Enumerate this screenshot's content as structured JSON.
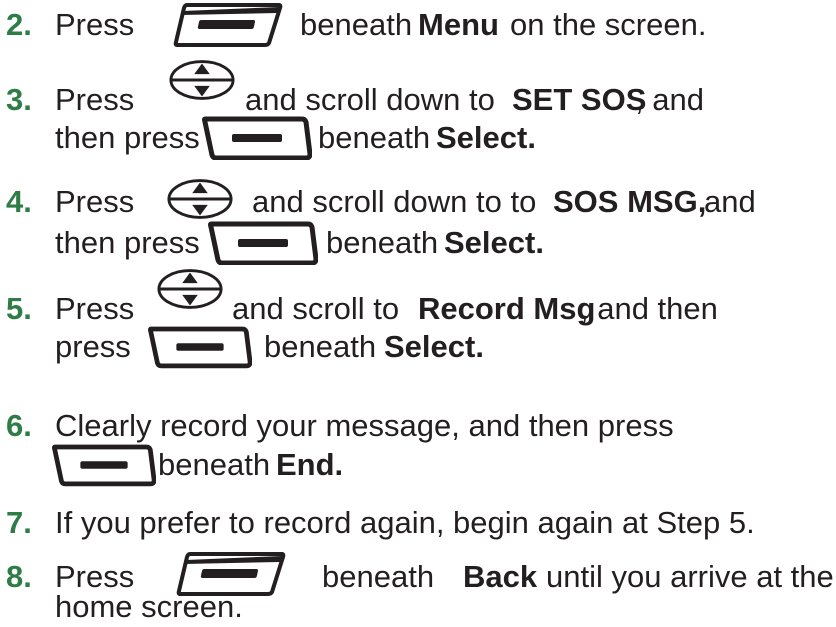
{
  "steps": [
    {
      "num": "2.",
      "a": "Press",
      "b": "beneath",
      "c": "Menu",
      "d": "on the screen."
    },
    {
      "num": "3.",
      "a": "Press",
      "b": "and scroll down to",
      "c": "SET SOS",
      "d": ", and"
    },
    {
      "a": "then press",
      "b": "beneath",
      "c": "Select."
    },
    {
      "num": "4.",
      "a": "Press",
      "b": "and scroll down to to",
      "c": "SOS MSG,",
      "d": "and"
    },
    {
      "a": "then press",
      "b": "beneath",
      "c": "Select."
    },
    {
      "num": "5.",
      "a": "Press",
      "b": "and scroll to",
      "c": "Record Msg",
      "d": ", and then"
    },
    {
      "a": "press",
      "b": "beneath",
      "c": "Select."
    },
    {
      "num": "6.",
      "a": "Clearly record your message, and then press"
    },
    {
      "b": "beneath",
      "c": "End."
    },
    {
      "num": "7.",
      "a": "If you prefer to record again, begin again at Step 5."
    },
    {
      "num": "8.",
      "a": "Press",
      "b": "beneath",
      "c": "Back",
      "d": "until you arrive at the"
    },
    {
      "a": "home screen."
    }
  ],
  "icons": {
    "softkey_left": "left-softkey-icon",
    "softkey_right": "right-softkey-icon",
    "nav": "scroll-nav-icon"
  },
  "colors": {
    "step_number": "#2f7d46",
    "text": "#231f20"
  }
}
